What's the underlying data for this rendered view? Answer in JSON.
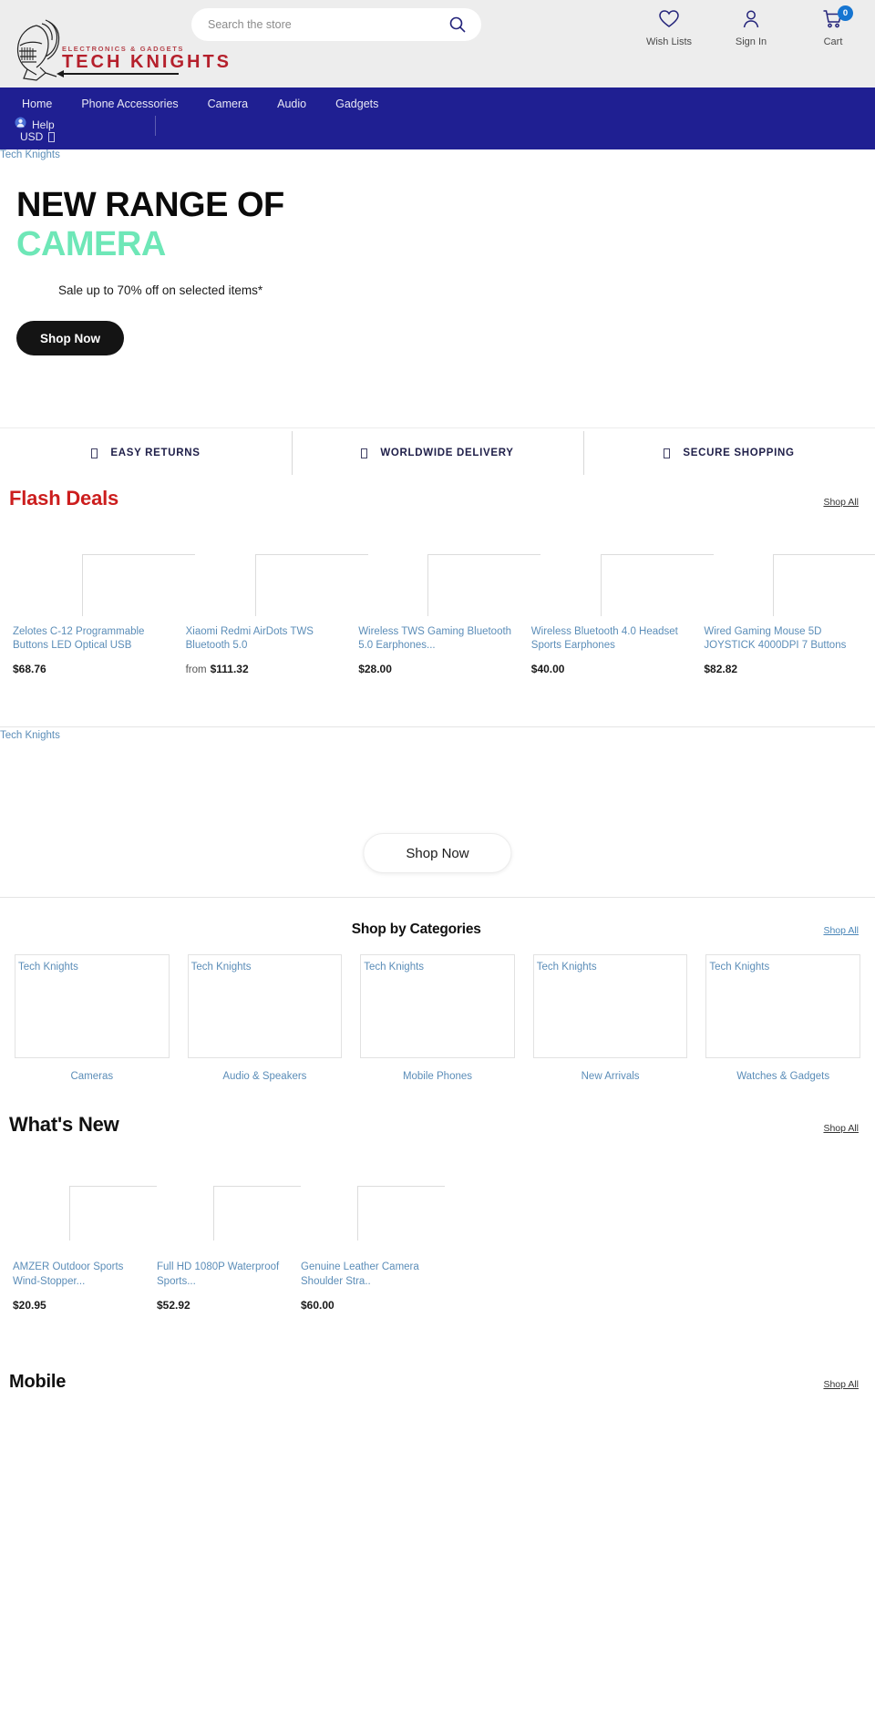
{
  "brand": {
    "kicker": "ELECTRONICS & GADGETS",
    "name": "TECH KNIGHTS",
    "alt_text": "Tech Knights"
  },
  "colors": {
    "nav_bg": "#1f1f92",
    "accent_red": "#cc1e1e",
    "accent_mint": "#6ee7b7",
    "link_blue": "#5b8db8",
    "badge_blue": "#1675d1"
  },
  "search": {
    "placeholder": "Search the store",
    "value": "",
    "icon": "search-icon"
  },
  "header_actions": [
    {
      "label": "Wish Lists",
      "icon": "heart-icon"
    },
    {
      "label": "Sign In",
      "icon": "user-icon"
    },
    {
      "label": "Cart",
      "icon": "cart-icon",
      "badge": "0"
    }
  ],
  "nav": {
    "items": [
      {
        "label": "Home"
      },
      {
        "label": "Phone Accessories"
      },
      {
        "label": "Camera"
      },
      {
        "label": "Audio"
      },
      {
        "label": "Gadgets"
      }
    ],
    "help_label": "Help",
    "help_icon": "user-circle-icon",
    "currency_label": "USD",
    "currency_caret": "▾"
  },
  "hero": {
    "image_alt": "Tech Knights",
    "title_line1": "NEW RANGE OF",
    "title_line2": "CAMERA",
    "subtitle": "Sale up to 70% off on selected items*",
    "cta_label": "Shop Now"
  },
  "benefits": [
    {
      "label": "EASY RETURNS",
      "icon": "return-box-icon"
    },
    {
      "label": "WORLDWIDE DELIVERY",
      "icon": "globe-truck-icon"
    },
    {
      "label": "SECURE SHOPPING",
      "icon": "lock-shield-icon"
    }
  ],
  "flash_deals": {
    "title": "Flash Deals",
    "shop_all_label": "Shop All",
    "products": [
      {
        "title": "Zelotes C-12 Programmable Buttons LED Optical USB",
        "price": "$68.76",
        "prefix": "",
        "image_alt": ""
      },
      {
        "title": "Xiaomi Redmi AirDots TWS Bluetooth 5.0",
        "price": "$111.32",
        "prefix": "from",
        "image_alt": ""
      },
      {
        "title": "Wireless TWS Gaming Bluetooth 5.0 Earphones...",
        "price": "$28.00",
        "prefix": "",
        "image_alt": ""
      },
      {
        "title": "Wireless Bluetooth 4.0 Headset Sports Earphones",
        "price": "$40.00",
        "prefix": "",
        "image_alt": ""
      },
      {
        "title": "Wired Gaming Mouse 5D JOYSTICK 4000DPI 7 Buttons",
        "price": "$82.82",
        "prefix": "",
        "image_alt": ""
      }
    ]
  },
  "promo": {
    "image_alt": "Tech Knights",
    "cta_label": "Shop Now"
  },
  "categories": {
    "title": "Shop by Categories",
    "shop_all_label": "Shop All",
    "items": [
      {
        "label": "Cameras",
        "image_alt": "Tech Knights"
      },
      {
        "label": "Audio & Speakers",
        "image_alt": "Tech Knights"
      },
      {
        "label": "Mobile Phones",
        "image_alt": "Tech Knights"
      },
      {
        "label": "New Arrivals",
        "image_alt": "Tech Knights"
      },
      {
        "label": "Watches & Gadgets",
        "image_alt": "Tech Knights"
      }
    ]
  },
  "whats_new": {
    "title": "What's New",
    "shop_all_label": "Shop All",
    "products": [
      {
        "title": "AMZER Outdoor Sports Wind-Stopper...",
        "price": "$20.95",
        "prefix": "",
        "image_alt": ""
      },
      {
        "title": "Full HD 1080P Waterproof Sports...",
        "price": "$52.92",
        "prefix": "",
        "image_alt": ""
      },
      {
        "title": "Genuine Leather Camera Shoulder Stra..",
        "price": "$60.00",
        "prefix": "",
        "image_alt": ""
      }
    ]
  },
  "mobile_section": {
    "title": "Mobile",
    "shop_all_label": "Shop All"
  }
}
